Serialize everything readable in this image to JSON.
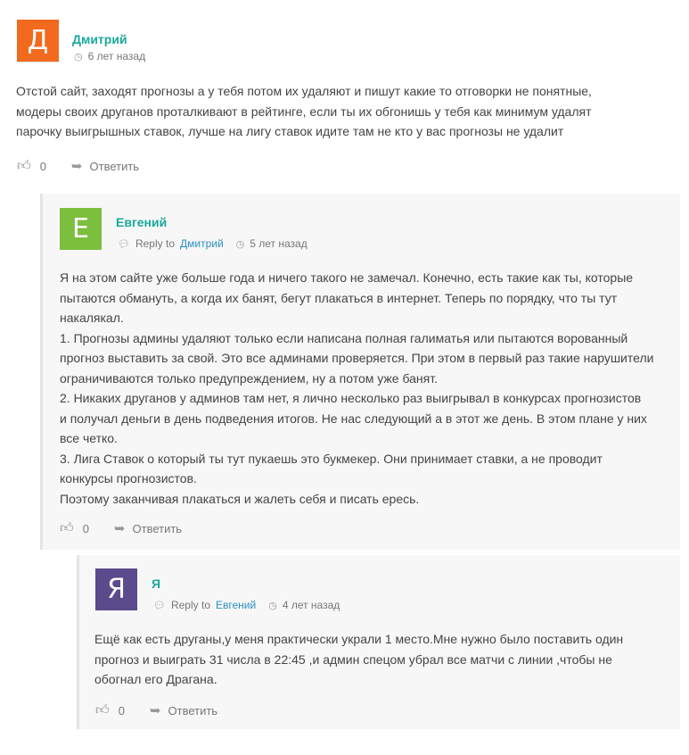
{
  "comments": [
    {
      "avatar_letter": "Д",
      "avatar_color": "#f26a1e",
      "author": "Дмитрий",
      "time": "6 лет назад",
      "text_lines": [
        "Отстой сайт, заходят прогнозы а у тебя потом их удаляют и пишут какие то отговорки не понятные,",
        "модеры своих друганов проталкивают в рейтинге, если ты их обгонишь у тебя как минимум удалят",
        "парочку выигрышных ставок, лучше на лигу ставок идите там не кто у вас прогнозы не удалит"
      ],
      "likes": "0",
      "reply_label": "Ответить"
    },
    {
      "avatar_letter": "Е",
      "avatar_color": "#7cbf3f",
      "author": "Евгений",
      "reply_to_label": "Reply to",
      "reply_to": "Дмитрий",
      "time": "5 лет назад",
      "text_lines": [
        "Я на этом сайте уже больше года и ничего такого не замечал. Конечно, есть такие как ты, которые",
        "пытаются обмануть, а когда их банят, бегут плакаться в интернет. Теперь по порядку, что ты тут",
        "накалякал.",
        "1. Прогнозы админы удаляют только если написана полная галиматья или пытаются ворованный",
        "прогноз выставить за свой. Это все админами проверяется. При этом в первый раз такие нарушители",
        "ограничиваются только предупреждением, ну а потом уже банят.",
        "2. Никаких друганов у админов там нет, я лично несколько раз выигрывал в конкурсах прогнозистов",
        "и получал деньги в день подведения итогов. Не нас следующий а в этот же день. В этом плане у них",
        "все четко.",
        "3. Лига Ставок о который ты тут пукаешь это букмекер. Они принимает ставки, а не проводит",
        "конкурсы прогнозистов.",
        "Поэтому заканчивая плакаться и жалеть себя и писать ересь."
      ],
      "likes": "0",
      "reply_label": "Ответить"
    },
    {
      "avatar_letter": "Я",
      "avatar_color": "#5b4a8c",
      "author": "Я",
      "reply_to_label": "Reply to",
      "reply_to": "Евгений",
      "time": "4 лет назад",
      "text_lines": [
        "Ещё как есть друганы,у меня практически украли 1 место.Мне нужно было поставить один",
        "прогноз и выиграть 31 числа в 22:45 ,и админ спецом убрал все матчи с линии ,чтобы не",
        "обогнал его Драгана."
      ],
      "likes": "0",
      "reply_label": "Ответить"
    }
  ]
}
